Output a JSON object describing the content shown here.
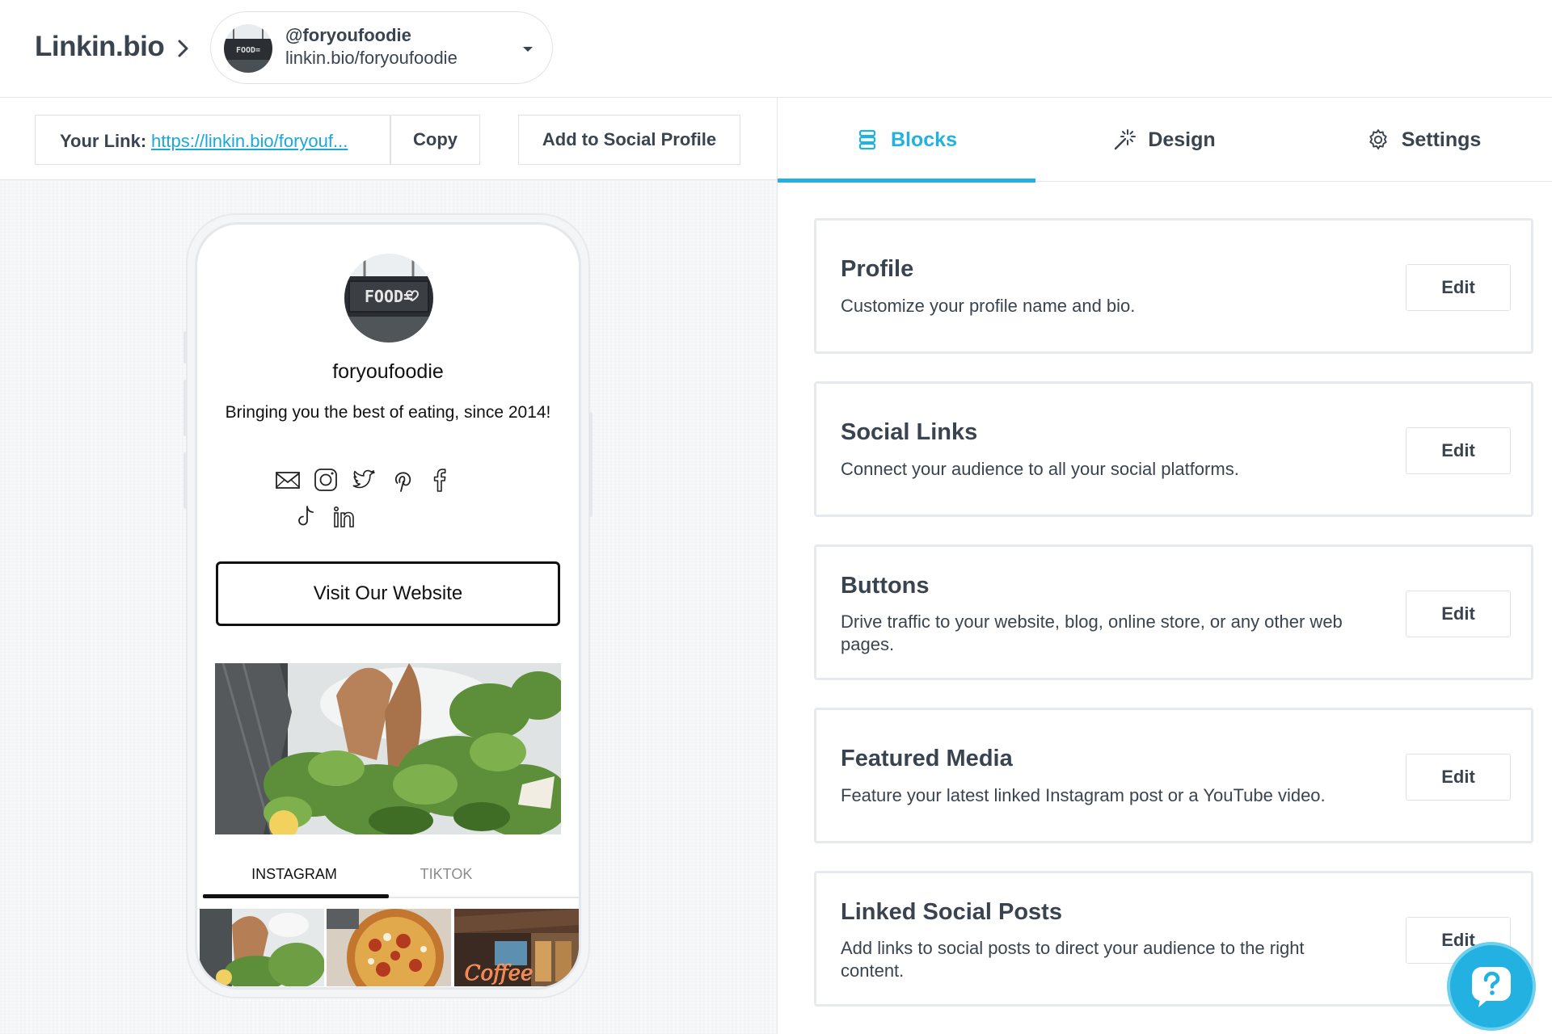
{
  "header": {
    "brand": "Linkin.bio",
    "account": {
      "handle": "@foryoufoodie",
      "url": "linkin.bio/foryoufoodie"
    }
  },
  "linkbar": {
    "your_link_label": "Your Link:",
    "your_link_value": "https://linkin.bio/foryouf...",
    "copy_label": "Copy",
    "add_social_label": "Add to Social Profile"
  },
  "preview": {
    "avatar_text": "FOOD=",
    "name": "foryoufoodie",
    "bio": "Bringing you the best of eating, since 2014!",
    "social_icons": [
      "mail-icon",
      "instagram-icon",
      "twitter-icon",
      "pinterest-icon",
      "facebook-icon",
      "tiktok-icon",
      "linkedin-icon"
    ],
    "button_label": "Visit Our Website",
    "tabs": [
      "INSTAGRAM",
      "TIKTOK"
    ],
    "thumb_text": "Coffee"
  },
  "tabs": [
    {
      "label": "Blocks",
      "icon": "blocks-icon",
      "active": true
    },
    {
      "label": "Design",
      "icon": "magic-wand-icon",
      "active": false
    },
    {
      "label": "Settings",
      "icon": "gear-icon",
      "active": false
    }
  ],
  "blocks": [
    {
      "title": "Profile",
      "description": "Customize your profile name and bio.",
      "edit_label": "Edit"
    },
    {
      "title": "Social Links",
      "description": "Connect your audience to all your social platforms.",
      "edit_label": "Edit"
    },
    {
      "title": "Buttons",
      "description": "Drive traffic to your website, blog, online store, or any other web pages.",
      "edit_label": "Edit"
    },
    {
      "title": "Featured Media",
      "description": "Feature your latest linked Instagram post or a YouTube video.",
      "edit_label": "Edit"
    },
    {
      "title": "Linked Social Posts",
      "description": "Add links to social posts to direct your audience to the right content.",
      "edit_label": "Edit"
    }
  ],
  "colors": {
    "accent": "#22b1e0",
    "text": "#3a4450",
    "link": "#1ba8d8"
  }
}
